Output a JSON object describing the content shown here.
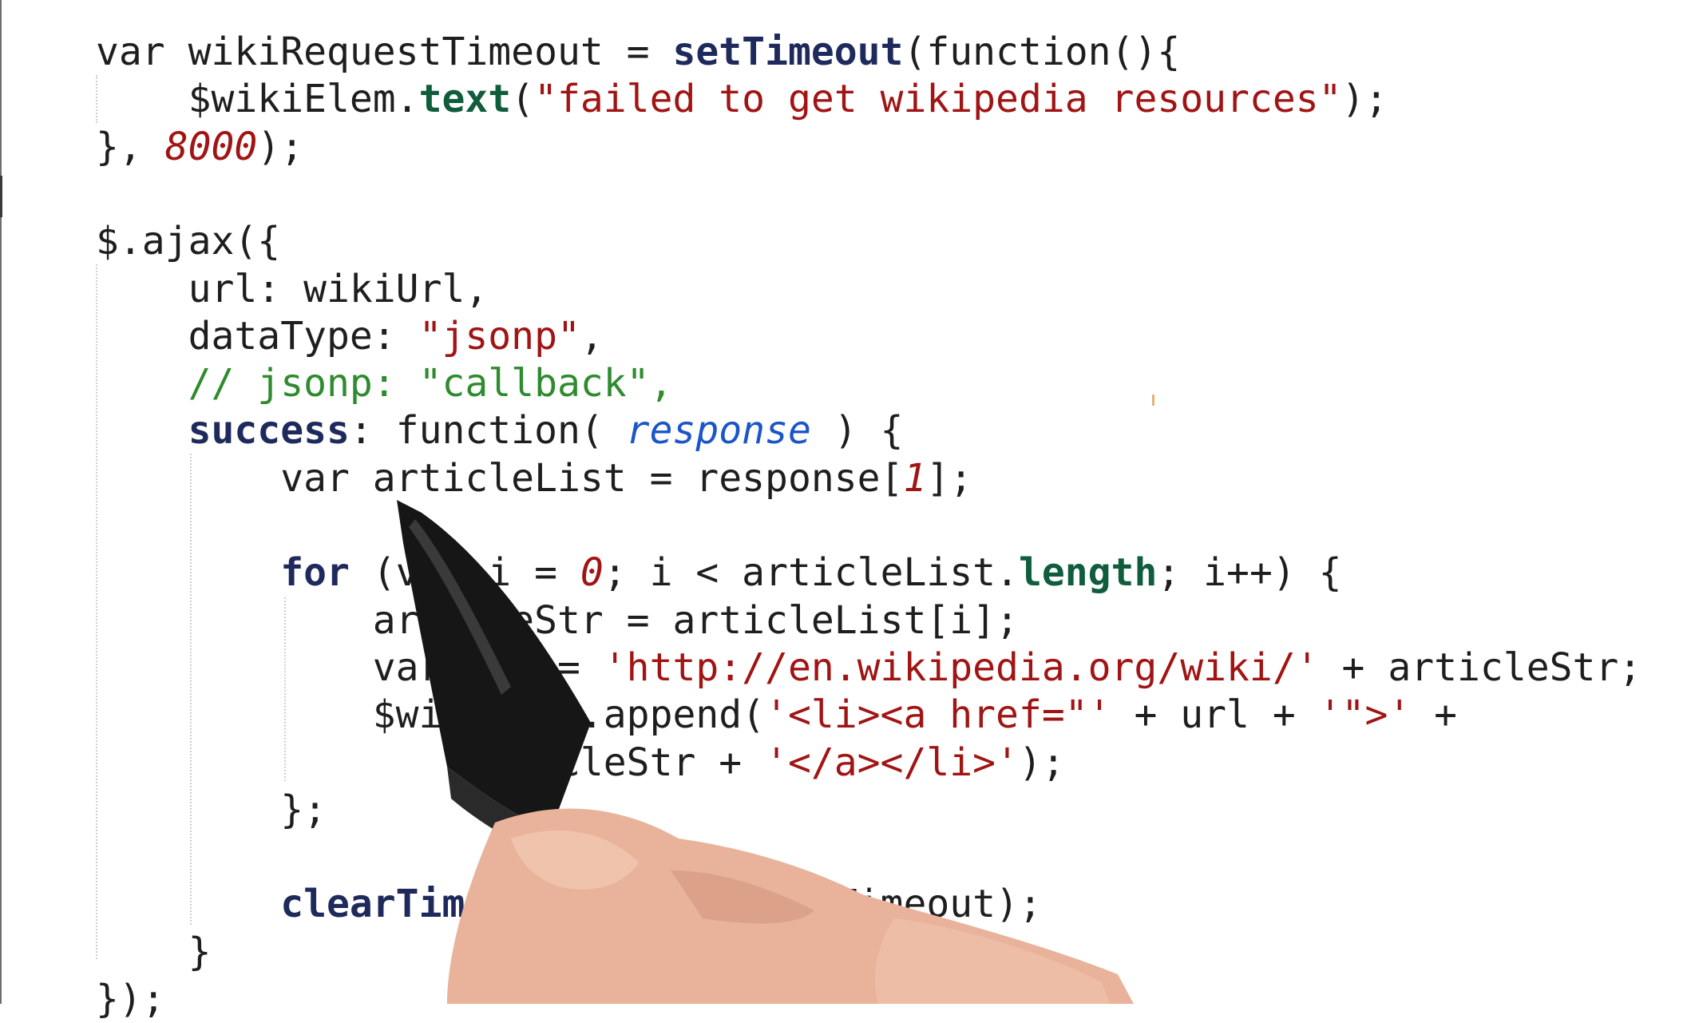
{
  "code_lines": [
    {
      "segments": [
        {
          "t": "var wikiRequestTimeout = ",
          "c": "plain"
        },
        {
          "t": "setTimeout",
          "c": "kw"
        },
        {
          "t": "(function(){",
          "c": "plain"
        }
      ]
    },
    {
      "segments": [
        {
          "t": "    $wikiElem.",
          "c": "plain"
        },
        {
          "t": "text",
          "c": "prop"
        },
        {
          "t": "(",
          "c": "plain"
        },
        {
          "t": "\"failed to get wikipedia resources\"",
          "c": "str"
        },
        {
          "t": ");",
          "c": "plain"
        }
      ]
    },
    {
      "segments": [
        {
          "t": "}, ",
          "c": "plain"
        },
        {
          "t": "8000",
          "c": "num"
        },
        {
          "t": ");",
          "c": "plain"
        }
      ]
    },
    {
      "segments": []
    },
    {
      "segments": [
        {
          "t": "$.ajax({",
          "c": "plain"
        }
      ]
    },
    {
      "segments": [
        {
          "t": "    url: wikiUrl,",
          "c": "plain"
        }
      ]
    },
    {
      "segments": [
        {
          "t": "    dataType: ",
          "c": "plain"
        },
        {
          "t": "\"jsonp\"",
          "c": "str"
        },
        {
          "t": ",",
          "c": "plain"
        }
      ]
    },
    {
      "segments": [
        {
          "t": "    // jsonp: \"callback\",",
          "c": "cm"
        }
      ]
    },
    {
      "segments": [
        {
          "t": "    ",
          "c": "plain"
        },
        {
          "t": "success",
          "c": "kw"
        },
        {
          "t": ": function( ",
          "c": "plain"
        },
        {
          "t": "response",
          "c": "prm"
        },
        {
          "t": " ) {",
          "c": "plain"
        }
      ]
    },
    {
      "segments": [
        {
          "t": "        var articleList = response[",
          "c": "plain"
        },
        {
          "t": "1",
          "c": "num"
        },
        {
          "t": "];",
          "c": "plain"
        }
      ]
    },
    {
      "segments": []
    },
    {
      "segments": [
        {
          "t": "        ",
          "c": "plain"
        },
        {
          "t": "for",
          "c": "kw"
        },
        {
          "t": " (var i = ",
          "c": "plain"
        },
        {
          "t": "0",
          "c": "num"
        },
        {
          "t": "; i < articleList.",
          "c": "plain"
        },
        {
          "t": "length",
          "c": "prop"
        },
        {
          "t": "; i++) {",
          "c": "plain"
        }
      ]
    },
    {
      "segments": [
        {
          "t": "            articleStr = articleList[i];",
          "c": "plain"
        }
      ]
    },
    {
      "segments": [
        {
          "t": "            var url = ",
          "c": "plain"
        },
        {
          "t": "'http://en.wikipedia.org/wiki/'",
          "c": "str"
        },
        {
          "t": " + articleStr;",
          "c": "plain"
        }
      ]
    },
    {
      "segments": [
        {
          "t": "            $wikiElem.append(",
          "c": "plain"
        },
        {
          "t": "'<li><a href=\"'",
          "c": "str"
        },
        {
          "t": " + url + ",
          "c": "plain"
        },
        {
          "t": "'\">'",
          "c": "str"
        },
        {
          "t": " +",
          "c": "plain"
        }
      ]
    },
    {
      "segments": [
        {
          "t": "                articleStr + ",
          "c": "plain"
        },
        {
          "t": "'</a></li>'",
          "c": "str"
        },
        {
          "t": ");",
          "c": "plain"
        }
      ]
    },
    {
      "segments": [
        {
          "t": "        };",
          "c": "plain"
        }
      ]
    },
    {
      "segments": []
    },
    {
      "segments": [
        {
          "t": "        ",
          "c": "plain"
        },
        {
          "t": "clearTimeout",
          "c": "kw"
        },
        {
          "t": "(wikiRequestTimeout);",
          "c": "plain"
        }
      ]
    },
    {
      "segments": [
        {
          "t": "    }",
          "c": "plain"
        }
      ]
    },
    {
      "segments": [
        {
          "t": "});",
          "c": "plain"
        }
      ]
    }
  ],
  "colors": {
    "keyword": "#1f2a5c",
    "string": "#a11414",
    "number": "#a11414",
    "comment": "#2e8b2e",
    "parameter": "#1c55c8",
    "property": "#0f5d3c",
    "plain": "#1e1e1e"
  },
  "overlay": {
    "icon": "hand-holding-pen-icon"
  }
}
